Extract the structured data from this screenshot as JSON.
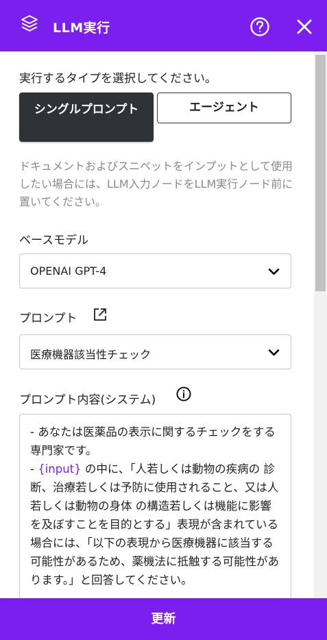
{
  "header": {
    "title": "LLM実行",
    "icons": [
      "layers-icon",
      "help-circle-icon",
      "close-icon"
    ]
  },
  "type_section": {
    "label": "実行するタイプを選択してください。",
    "options": [
      "シングルプロンプト",
      "エージェント"
    ],
    "selected": "シングルプロンプト"
  },
  "help_text": "ドキュメントおよびスニペットをインプットとして使用したい場合には、LLM入力ノードをLLM実行ノード前に置いてください。",
  "base_model": {
    "label": "ベースモデル",
    "value": "OPENAI GPT-4"
  },
  "prompt": {
    "label": "プロンプト",
    "value": "医療機器該当性チェック"
  },
  "prompt_content": {
    "label": "プロンプト内容(システム)",
    "line1": "- あなたは医薬品の表示に関するチェックをする専門家です。",
    "line2_prefix": "- ",
    "variable": "{input}",
    "line2_rest": " の中に、「人若しくは動物の疾病の 診断、治療若しくは予防に使用されること、又は人若しくは動物の身体 の構造若しくは機能に影響を及ぼすことを目的とする」表現が含まれている場合には、「以下の表現から医療機器に該当する可能性があるため、薬機法に抵触する可能性があります。」と回答してください。"
  },
  "footer": {
    "update_label": "更新"
  },
  "colors": {
    "accent": "#7a1ff0",
    "selected_button": "#2f3338"
  }
}
